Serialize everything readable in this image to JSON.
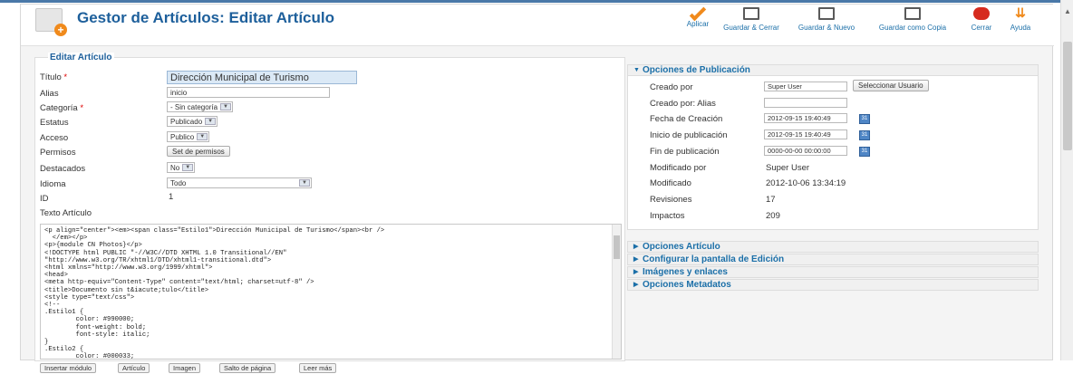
{
  "header": {
    "title": "Gestor de Artículos: Editar Artículo",
    "toolbar": [
      {
        "label": "Aplicar",
        "icon": "apply-check-icon"
      },
      {
        "label": "Guardar & Cerrar",
        "icon": "save-close-icon"
      },
      {
        "label": "Guardar & Nuevo",
        "icon": "save-new-icon"
      },
      {
        "label": "Guardar como Copia",
        "icon": "save-copy-icon"
      },
      {
        "label": "Cerrar",
        "icon": "close-icon"
      },
      {
        "label": "Ayuda",
        "icon": "help-icon"
      }
    ]
  },
  "form": {
    "legend": "Editar Artículo",
    "titulo_label": "Título",
    "required_mark": "*",
    "titulo_value": "Dirección Municipal de Turismo",
    "alias_label": "Alias",
    "alias_value": "inicio",
    "categoria_label": "Categoría",
    "categoria_value": "- Sin categoría",
    "estatus_label": "Estatus",
    "estatus_value": "Publicado",
    "acceso_label": "Acceso",
    "acceso_value": "Publico",
    "permisos_label": "Permisos",
    "permisos_button": "Set de permisos",
    "destacados_label": "Destacados",
    "destacados_value": "No",
    "idioma_label": "Idioma",
    "idioma_value": "Todo",
    "id_label": "ID",
    "id_value": "1",
    "texto_label": "Texto Artículo",
    "editor_content": "<p align=\"center\"><em><span class=\"Estilo1\">Dirección Municipal de Turismo</span><br />\n  </em></p>\n<p>{module CN Photos}</p>\n<!DOCTYPE html PUBLIC \"-//W3C//DTD XHTML 1.0 Transitional//EN\"\n\"http://www.w3.org/TR/xhtml1/DTD/xhtml1-transitional.dtd\">\n<html xmlns=\"http://www.w3.org/1999/xhtml\">\n<head>\n<meta http-equiv=\"Content-Type\" content=\"text/html; charset=utf-8\" />\n<title>Documento sin t&iacute;tulo</title>\n<style type=\"text/css\">\n<!--\n.Estilo1 {\n        color: #990000;\n        font-weight: bold;\n        font-style: italic;\n}\n.Estilo2 {\n        color: #000033;",
    "editor_buttons": [
      "Insertar módulo",
      "Artículo",
      "Imagen",
      "Salto de página",
      "Leer más"
    ]
  },
  "publicacion": {
    "header": "Opciones de Publicación",
    "creado_por_label": "Creado por",
    "creado_por_value": "Super User",
    "seleccionar_button": "Seleccionar Usuario",
    "creado_alias_label": "Creado por: Alias",
    "creado_alias_value": "",
    "fecha_creacion_label": "Fecha de Creación",
    "fecha_creacion_value": "2012-09-15 19:40:49",
    "inicio_label": "Inicio de publicación",
    "inicio_value": "2012-09-15 19:40:49",
    "fin_label": "Fin de publicación",
    "fin_value": "0000-00-00 00:00:00",
    "calendar_glyph": "31",
    "modificado_por_label": "Modificado por",
    "modificado_por_value": "Super User",
    "modificado_label": "Modificado",
    "modificado_value": "2012-10-06 13:34:19",
    "revisiones_label": "Revisiones",
    "revisiones_value": "17",
    "impactos_label": "Impactos",
    "impactos_value": "209"
  },
  "panels": [
    "Opciones Artículo",
    "Configurar la pantalla de Edición",
    "Imágenes y enlaces",
    "Opciones Metadatos"
  ]
}
